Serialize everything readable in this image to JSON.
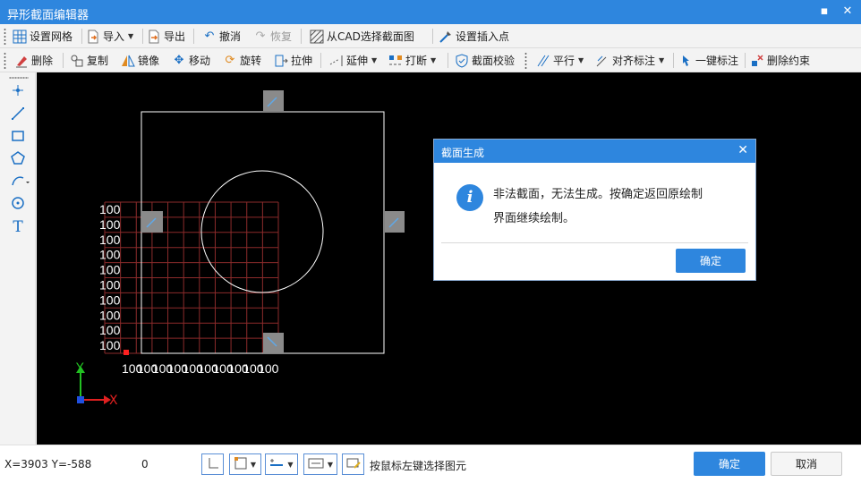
{
  "window": {
    "title": "异形截面编辑器",
    "minimize_glyph": "▪",
    "close_glyph": "✕"
  },
  "toolbar1": {
    "set_grid": "设置网格",
    "import": "导入",
    "export": "导出",
    "undo": "撤消",
    "redo": "恢复",
    "select_from_cad": "从CAD选择截面图",
    "set_insert_point": "设置插入点"
  },
  "toolbar2": {
    "delete": "删除",
    "copy": "复制",
    "mirror": "镜像",
    "move": "移动",
    "rotate": "旋转",
    "stretch": "拉伸",
    "extend": "延伸",
    "break": "打断",
    "section_check": "截面校验",
    "parallel": "平行",
    "align_dim": "对齐标注",
    "one_click_dim": "一键标注",
    "remove_constraint": "删除约束"
  },
  "left_tools": [
    {
      "name": "point-tool",
      "icon": "point-icon"
    },
    {
      "name": "line-tool",
      "icon": "line-icon"
    },
    {
      "name": "rect-tool",
      "icon": "rect-icon"
    },
    {
      "name": "polygon-tool",
      "icon": "polygon-icon"
    },
    {
      "name": "arc-tool",
      "icon": "arc-icon"
    },
    {
      "name": "circle-tool",
      "icon": "circle-icon"
    },
    {
      "name": "text-tool",
      "icon": "text-icon"
    }
  ],
  "canvas": {
    "grid_labels_y": [
      "100",
      "100",
      "100",
      "100",
      "100",
      "100",
      "100",
      "100",
      "100",
      "100"
    ],
    "grid_labels_x": [
      "100",
      "100",
      "100",
      "100",
      "100",
      "100",
      "100",
      "100",
      "100",
      "100"
    ],
    "axis_y": "Y",
    "axis_x": "X",
    "colors": {
      "background": "#000000",
      "grid": "#8b2b2b",
      "shape": "#ffffff",
      "axis_y": "#22c022",
      "axis_x": "#e02020"
    }
  },
  "dialog": {
    "title": "截面生成",
    "message_line1": "非法截面，无法生成。按确定返回原绘制",
    "message_line2": "界面继续绘制。",
    "ok": "确定",
    "icon": "info-icon"
  },
  "status": {
    "coords": "X=3903 Y=-588",
    "value": "0",
    "hint": "按鼠标左键选择图元",
    "ok": "确定",
    "cancel": "取消"
  },
  "colors": {
    "accent": "#2e86de"
  }
}
